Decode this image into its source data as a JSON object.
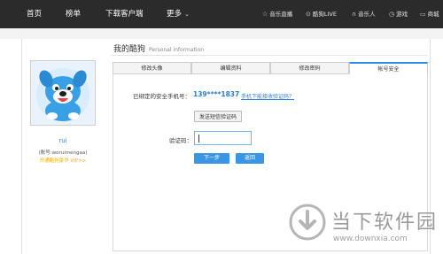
{
  "topnav": {
    "items": [
      "首页",
      "榜单",
      "下载客户端",
      "更多"
    ],
    "right_items": [
      {
        "icon": "star-icon",
        "label": "音乐直播"
      },
      {
        "icon": "live-icon",
        "label": "酷狗LIVE"
      },
      {
        "icon": "headphones-icon",
        "label": "音乐人"
      },
      {
        "icon": "game-icon",
        "label": "游戏"
      },
      {
        "icon": "mall-icon",
        "label": "商城"
      }
    ],
    "colors": {
      "bar": "#2b2b2b",
      "text": "#ffffff"
    }
  },
  "profile": {
    "username": "rui",
    "account": "(账号:woruimengaa)",
    "vip_link": "开通酷狗豪华 VIP>>"
  },
  "section": {
    "title": "我的酷狗",
    "subtitle": "Personal information"
  },
  "tabs": [
    {
      "label": "修改头像",
      "active": false
    },
    {
      "label": "编辑资料",
      "active": false
    },
    {
      "label": "修改密码",
      "active": false
    },
    {
      "label": "帐号安全",
      "active": true
    }
  ],
  "security": {
    "phone_label": "已绑定的安全手机号：",
    "phone_value": "139****1837",
    "phone_link": "手机下能接收验证码？",
    "send_button": "发送短信验证码",
    "code_label": "验证码：",
    "code_value": "",
    "next_button": "下一步",
    "back_button": "返回"
  },
  "watermark": {
    "text": "当下软件园",
    "url": "www.downxia.com"
  },
  "accent": "#2f8fe0"
}
